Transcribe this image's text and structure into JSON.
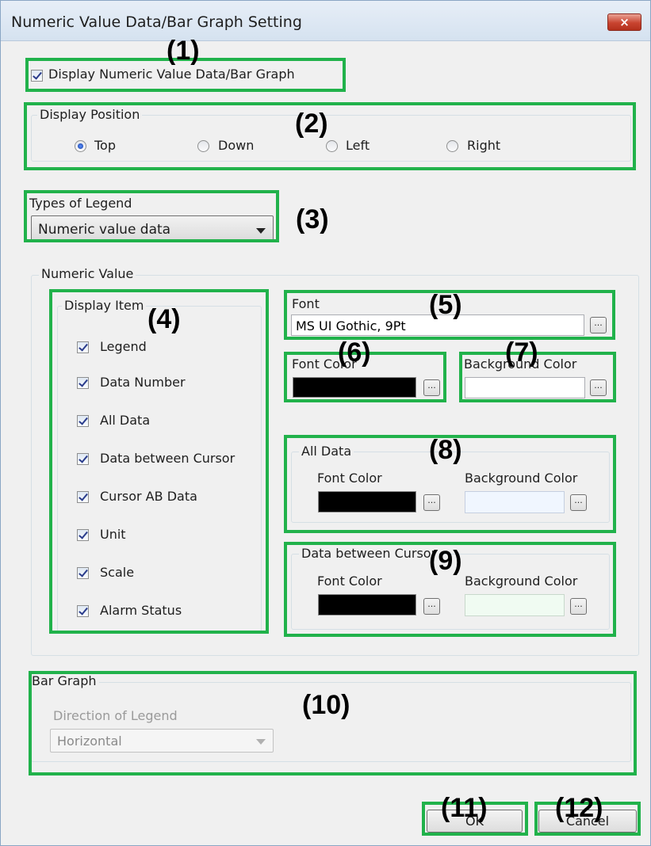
{
  "window": {
    "title": "Numeric Value Data/Bar Graph Setting",
    "close_label": "×"
  },
  "display_checkbox_label": "Display Numeric Value Data/Bar Graph",
  "display_position": {
    "title": "Display Position",
    "options": [
      "Top",
      "Down",
      "Left",
      "Right"
    ],
    "selected": "Top"
  },
  "legend_type": {
    "title": "Types of Legend",
    "value": "Numeric value data"
  },
  "numeric_value": {
    "title": "Numeric Value",
    "display_item": {
      "title": "Display Item",
      "items": [
        "Legend",
        "Data Number",
        "All Data",
        "Data between Cursor",
        "Cursor AB Data",
        "Unit",
        "Scale",
        "Alarm Status"
      ]
    },
    "font": {
      "title": "Font",
      "value": "MS UI Gothic, 9Pt",
      "button": "..."
    },
    "font_color": {
      "title": "Font Color",
      "color": "#000000",
      "button": "..."
    },
    "background_color": {
      "title": "Background Color",
      "color": "#ffffff",
      "button": "..."
    },
    "all_data": {
      "title": "All Data",
      "font_color_label": "Font Color",
      "font_color": "#000000",
      "bg_color_label": "Background Color",
      "bg_color": "#f0f6ff",
      "button": "..."
    },
    "data_between_cursor": {
      "title": "Data between Cursor",
      "font_color_label": "Font Color",
      "font_color": "#000000",
      "bg_color_label": "Background Color",
      "bg_color": "#f0fbf2",
      "button": "..."
    }
  },
  "bar_graph": {
    "title": "Bar Graph",
    "direction_label": "Direction of Legend",
    "direction_value": "Horizontal"
  },
  "buttons": {
    "ok": "OK",
    "cancel": "Cancel"
  },
  "annotations": [
    "(1)",
    "(2)",
    "(3)",
    "(4)",
    "(5)",
    "(6)",
    "(7)",
    "(8)",
    "(9)",
    "(10)",
    "(11)",
    "(12)"
  ],
  "colors": {
    "highlight": "#21b24b",
    "close_button": "#c8432f"
  }
}
